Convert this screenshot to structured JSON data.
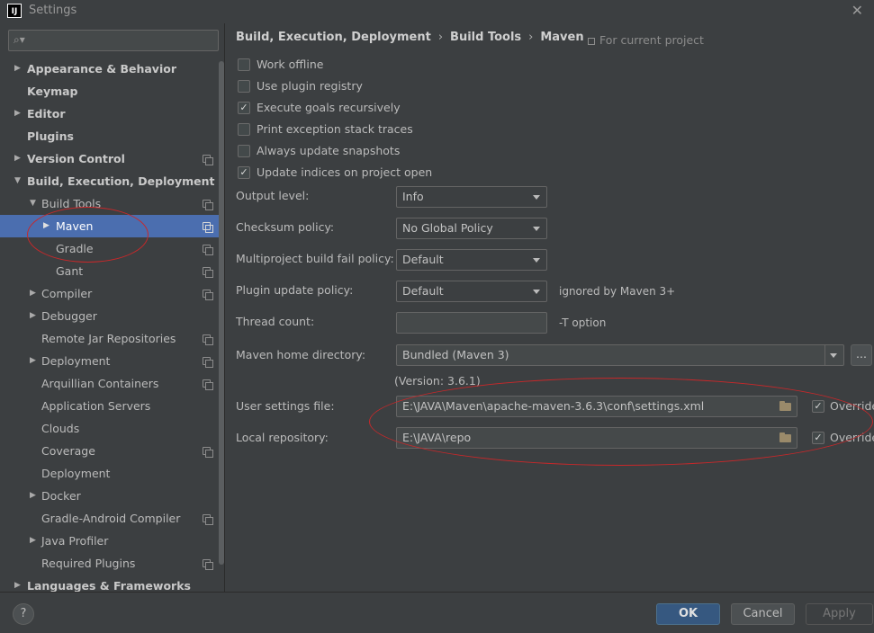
{
  "window": {
    "logo": "IJ",
    "title": "Settings",
    "close": "✕"
  },
  "search": {
    "placeholder": "",
    "icon": "search-icon"
  },
  "tree": [
    {
      "label": "Appearance & Behavior",
      "level": 0,
      "arrow": "▶",
      "bold": true,
      "proj": false
    },
    {
      "label": "Keymap",
      "level": 0,
      "arrow": "",
      "bold": true,
      "proj": false
    },
    {
      "label": "Editor",
      "level": 0,
      "arrow": "▶",
      "bold": true,
      "proj": false
    },
    {
      "label": "Plugins",
      "level": 0,
      "arrow": "",
      "bold": true,
      "proj": false
    },
    {
      "label": "Version Control",
      "level": 0,
      "arrow": "▶",
      "bold": true,
      "proj": true
    },
    {
      "label": "Build, Execution, Deployment",
      "level": 0,
      "arrow": "▼",
      "bold": true,
      "proj": false
    },
    {
      "label": "Build Tools",
      "level": 1,
      "arrow": "▼",
      "bold": false,
      "proj": true
    },
    {
      "label": "Maven",
      "level": 2,
      "arrow": "▶",
      "bold": false,
      "proj": true,
      "selected": true
    },
    {
      "label": "Gradle",
      "level": 2,
      "arrow": "",
      "bold": false,
      "proj": true
    },
    {
      "label": "Gant",
      "level": 2,
      "arrow": "",
      "bold": false,
      "proj": true
    },
    {
      "label": "Compiler",
      "level": 1,
      "arrow": "▶",
      "bold": false,
      "proj": true
    },
    {
      "label": "Debugger",
      "level": 1,
      "arrow": "▶",
      "bold": false,
      "proj": false
    },
    {
      "label": "Remote Jar Repositories",
      "level": 1,
      "arrow": "",
      "bold": false,
      "proj": true
    },
    {
      "label": "Deployment",
      "level": 1,
      "arrow": "▶",
      "bold": false,
      "proj": true
    },
    {
      "label": "Arquillian Containers",
      "level": 1,
      "arrow": "",
      "bold": false,
      "proj": true
    },
    {
      "label": "Application Servers",
      "level": 1,
      "arrow": "",
      "bold": false,
      "proj": false
    },
    {
      "label": "Clouds",
      "level": 1,
      "arrow": "",
      "bold": false,
      "proj": false
    },
    {
      "label": "Coverage",
      "level": 1,
      "arrow": "",
      "bold": false,
      "proj": true
    },
    {
      "label": "Deployment",
      "level": 1,
      "arrow": "",
      "bold": false,
      "proj": false
    },
    {
      "label": "Docker",
      "level": 1,
      "arrow": "▶",
      "bold": false,
      "proj": false
    },
    {
      "label": "Gradle-Android Compiler",
      "level": 1,
      "arrow": "",
      "bold": false,
      "proj": true
    },
    {
      "label": "Java Profiler",
      "level": 1,
      "arrow": "▶",
      "bold": false,
      "proj": false
    },
    {
      "label": "Required Plugins",
      "level": 1,
      "arrow": "",
      "bold": false,
      "proj": true
    },
    {
      "label": "Languages & Frameworks",
      "level": 0,
      "arrow": "▶",
      "bold": true,
      "proj": false
    }
  ],
  "breadcrumb": {
    "part1": "Build, Execution, Deployment",
    "part2": "Build Tools",
    "part3": "Maven",
    "sep": "›",
    "for_project": "For current project"
  },
  "checkboxes": [
    {
      "label": "Work offline",
      "checked": false
    },
    {
      "label": "Use plugin registry",
      "checked": false
    },
    {
      "label": "Execute goals recursively",
      "checked": true
    },
    {
      "label": "Print exception stack traces",
      "checked": false
    },
    {
      "label": "Always update snapshots",
      "checked": false
    },
    {
      "label": "Update indices on project open",
      "checked": true
    }
  ],
  "check_glyph": "✓",
  "fields": {
    "output_level": {
      "label": "Output level:",
      "value": "Info"
    },
    "checksum_policy": {
      "label": "Checksum policy:",
      "value": "No Global Policy"
    },
    "multiproject_fail": {
      "label": "Multiproject build fail policy:",
      "value": "Default"
    },
    "plugin_update": {
      "label": "Plugin update policy:",
      "value": "Default",
      "hint": "ignored by Maven 3+"
    },
    "thread_count": {
      "label": "Thread count:",
      "value": "",
      "hint": "-T option"
    },
    "maven_home": {
      "label": "Maven home directory:",
      "value": "Bundled (Maven 3)",
      "browse": "...",
      "version": "(Version: 3.6.1)"
    },
    "user_settings": {
      "label": "User settings file:",
      "value": "E:\\JAVA\\Maven\\apache-maven-3.6.3\\conf\\settings.xml",
      "override": "Override",
      "override_checked": true
    },
    "local_repo": {
      "label": "Local repository:",
      "value": "E:\\JAVA\\repo",
      "override": "Override",
      "override_checked": true
    }
  },
  "footer": {
    "help": "?",
    "ok": "OK",
    "cancel": "Cancel",
    "apply": "Apply"
  },
  "colors": {
    "selection": "#4b6eaf",
    "annotation": "#c8282a",
    "ok_button": "#365880"
  }
}
